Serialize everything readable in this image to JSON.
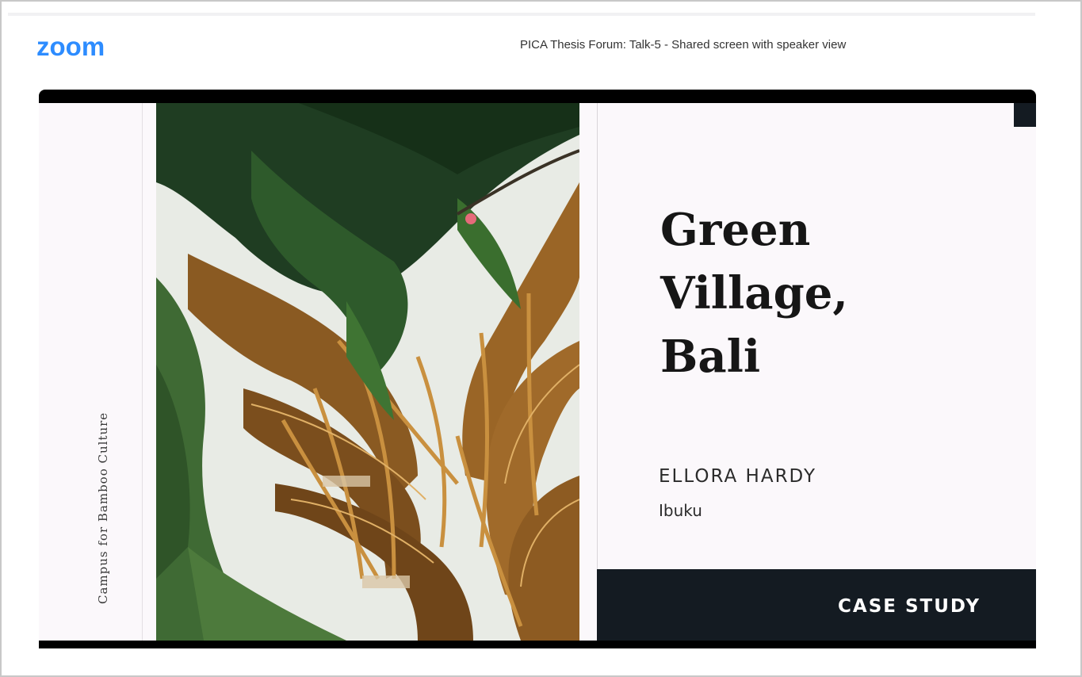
{
  "app": {
    "logo_text": "zoom",
    "meeting_title": "PICA Thesis Forum: Talk-5 - Shared screen with speaker view"
  },
  "slide": {
    "vertical_caption": "Campus for Bamboo Culture",
    "title_line1": "Green Village,",
    "title_line2": "Bali",
    "person_name": "ELLORA HARDY",
    "company": "Ibuku",
    "case_label": "CASE STUDY",
    "photo_subject": "bamboo-structure-photo"
  },
  "colors": {
    "zoom_blue": "#2d8cff",
    "dark_navy": "#141b22",
    "slide_bg": "#fbf8fb",
    "bamboo": "#a8742f"
  }
}
